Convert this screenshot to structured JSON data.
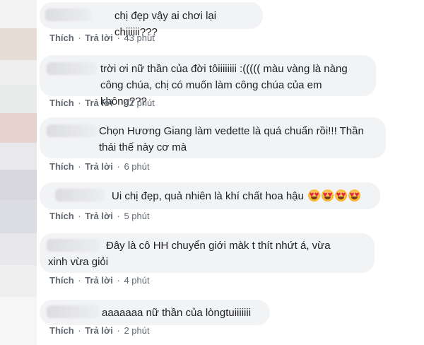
{
  "actions": {
    "like": "Thích",
    "reply": "Trả lời",
    "separator": "·"
  },
  "comments": [
    {
      "text": "chị đẹp vậy ai chơi lại chịiiiii???",
      "time": "43 phút"
    },
    {
      "text": "trời ơi nữ thần của đời tôiiiiiiii :((((( màu vàng là nàng công chúa, chị có muốn làm công chúa của em không???",
      "time": "42 phút"
    },
    {
      "text": "Chọn Hương Giang làm vedette là quá chuẩn rồi!!! Thần thái thế này cơ mà",
      "time": "6 phút"
    },
    {
      "text": "Ui chị đẹp, quả nhiên là khí chất hoa hậu",
      "emoji": "heart-eyes-icon",
      "emoji_count": 4,
      "time": "5 phút"
    },
    {
      "text": "Đây là cô HH chuyển giới màk t thít nhứt á, vừa xinh vừa giỏi",
      "time": "4 phút"
    },
    {
      "text": "aaaaaaa nữ thần của lòngtuiiiiiii",
      "time": "2 phút"
    }
  ],
  "colors": {
    "bubble_bg": "#f2f3f5",
    "text": "#1c1e21",
    "meta_text": "#606770"
  }
}
